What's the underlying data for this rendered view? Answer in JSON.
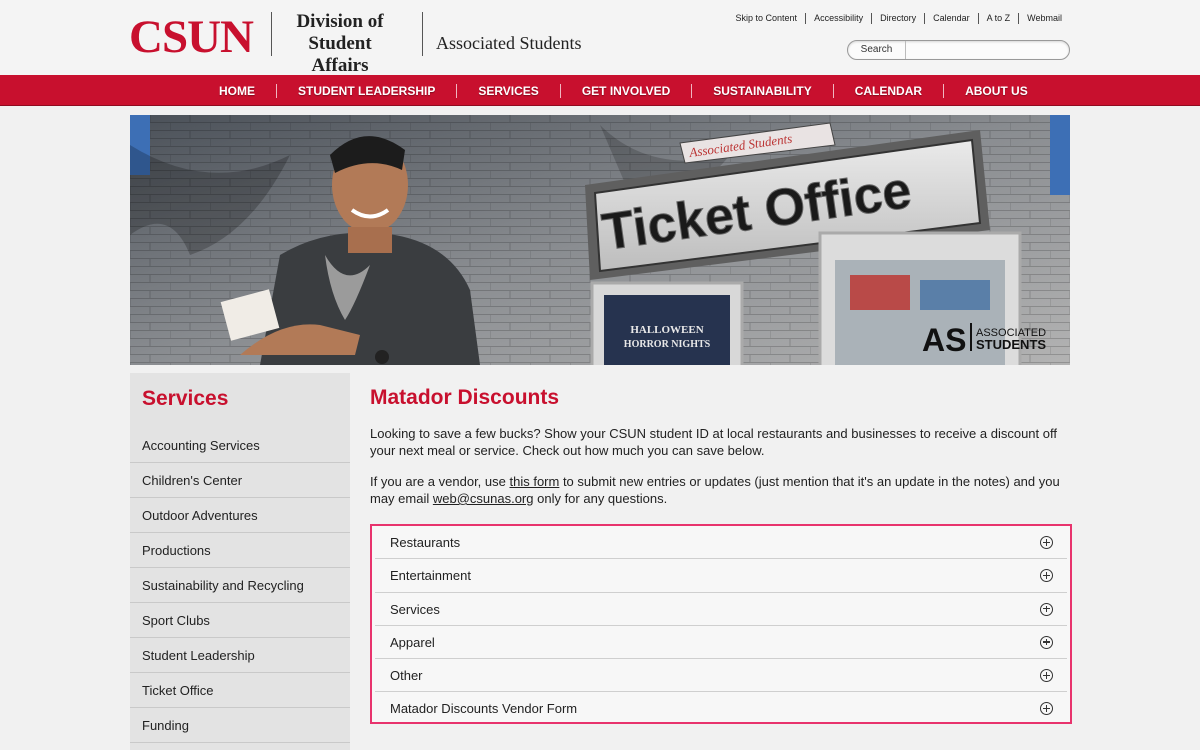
{
  "header": {
    "logo_csun": "CSUN",
    "logo_division_line1": "Division of",
    "logo_division_line2": "Student Affairs",
    "logo_associated": "Associated Students",
    "util_links": [
      "Skip to Content",
      "Accessibility",
      "Directory",
      "Calendar",
      "A to Z",
      "Webmail"
    ],
    "search_label": "Search",
    "search_placeholder": ""
  },
  "nav": {
    "items": [
      "HOME",
      "STUDENT LEADERSHIP",
      "SERVICES",
      "GET INVOLVED",
      "SUSTAINABILITY",
      "CALENDAR",
      "ABOUT US"
    ]
  },
  "hero": {
    "sign_text": "Ticket Office",
    "sign_small": "Associated Students",
    "poster_text_line1": "HALLOWEEN",
    "poster_text_line2": "HORROR NIGHTS",
    "badge_as": "AS",
    "badge_line1": "ASSOCIATED",
    "badge_line2": "STUDENTS"
  },
  "sidebar": {
    "title": "Services",
    "items": [
      "Accounting Services",
      "Children's Center",
      "Outdoor Adventures",
      "Productions",
      "Sustainability and Recycling",
      "Sport Clubs",
      "Student Leadership",
      "Ticket Office",
      "Funding"
    ]
  },
  "main": {
    "title": "Matador Discounts",
    "intro": "Looking to save a few bucks? Show your CSUN student ID at local restaurants and businesses to receive a discount off your next meal or service. Check out how much you can save below.",
    "vendor_before": "If you are a vendor, use ",
    "vendor_link": "this form",
    "vendor_middle": " to submit new entries or updates (just mention that it's an update in the notes) and you may email ",
    "vendor_email": "web@csunas.org",
    "vendor_after": " only for any questions."
  },
  "accordion": {
    "items": [
      "Restaurants",
      "Entertainment",
      "Services",
      "Apparel",
      "Other",
      "Matador Discounts Vendor Form"
    ]
  },
  "colors": {
    "brand_red": "#c8102e",
    "highlight_pink": "#e8336d"
  }
}
